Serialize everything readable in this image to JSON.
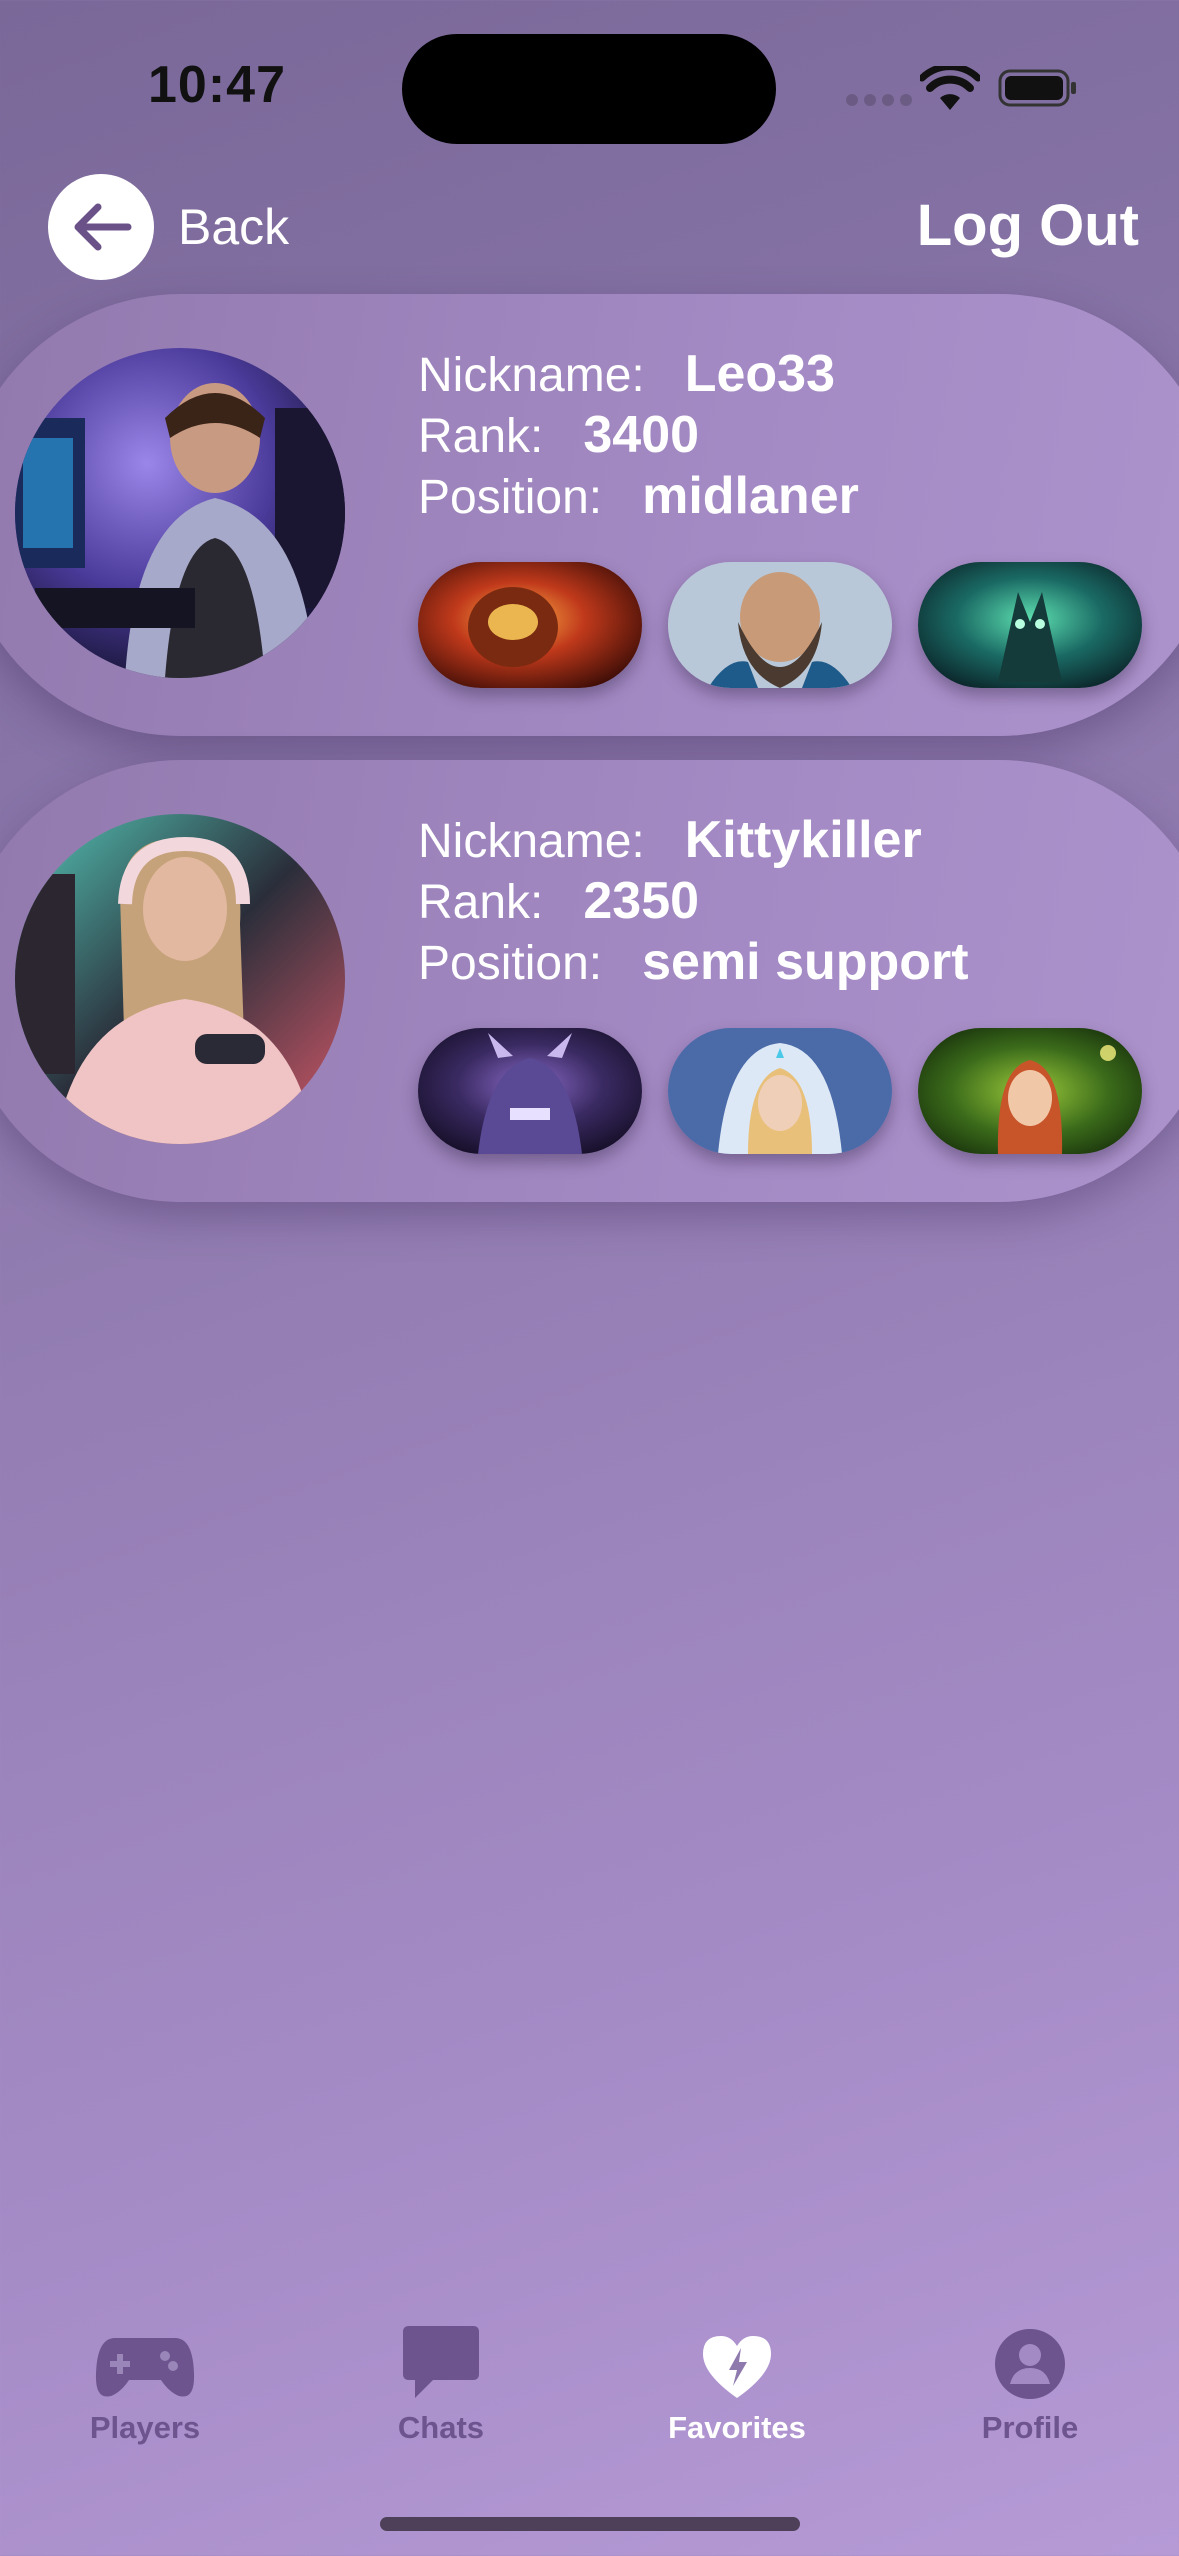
{
  "status_bar": {
    "time": "10:47"
  },
  "nav": {
    "back_label": "Back",
    "logout_label": "Log Out"
  },
  "labels": {
    "nickname": "Nickname:",
    "rank": "Rank:",
    "position": "Position:"
  },
  "players": [
    {
      "nickname": "Leo33",
      "rank": "3400",
      "position": "midlaner",
      "avatar": "gamer-avatar-man",
      "heroes": [
        "ember-hero-portrait",
        "kunkka-hero-portrait",
        "undying-hero-portrait"
      ]
    },
    {
      "nickname": "Kittykiller",
      "rank": "2350",
      "position": "semi support",
      "avatar": "gamer-avatar-woman",
      "heroes": [
        "spectre-hero-portrait",
        "crystal-maiden-hero-portrait",
        "enchantress-hero-portrait"
      ]
    }
  ],
  "tabs": [
    {
      "label": "Players",
      "icon": "gamepad-icon",
      "active": false
    },
    {
      "label": "Chats",
      "icon": "chat-bubble-icon",
      "active": false
    },
    {
      "label": "Favorites",
      "icon": "heart-bolt-icon",
      "active": true
    },
    {
      "label": "Profile",
      "icon": "person-circle-icon",
      "active": false
    }
  ],
  "colors": {
    "accent": "#6d548e",
    "card": "#a48ac4",
    "active_tab": "#ffffff"
  }
}
